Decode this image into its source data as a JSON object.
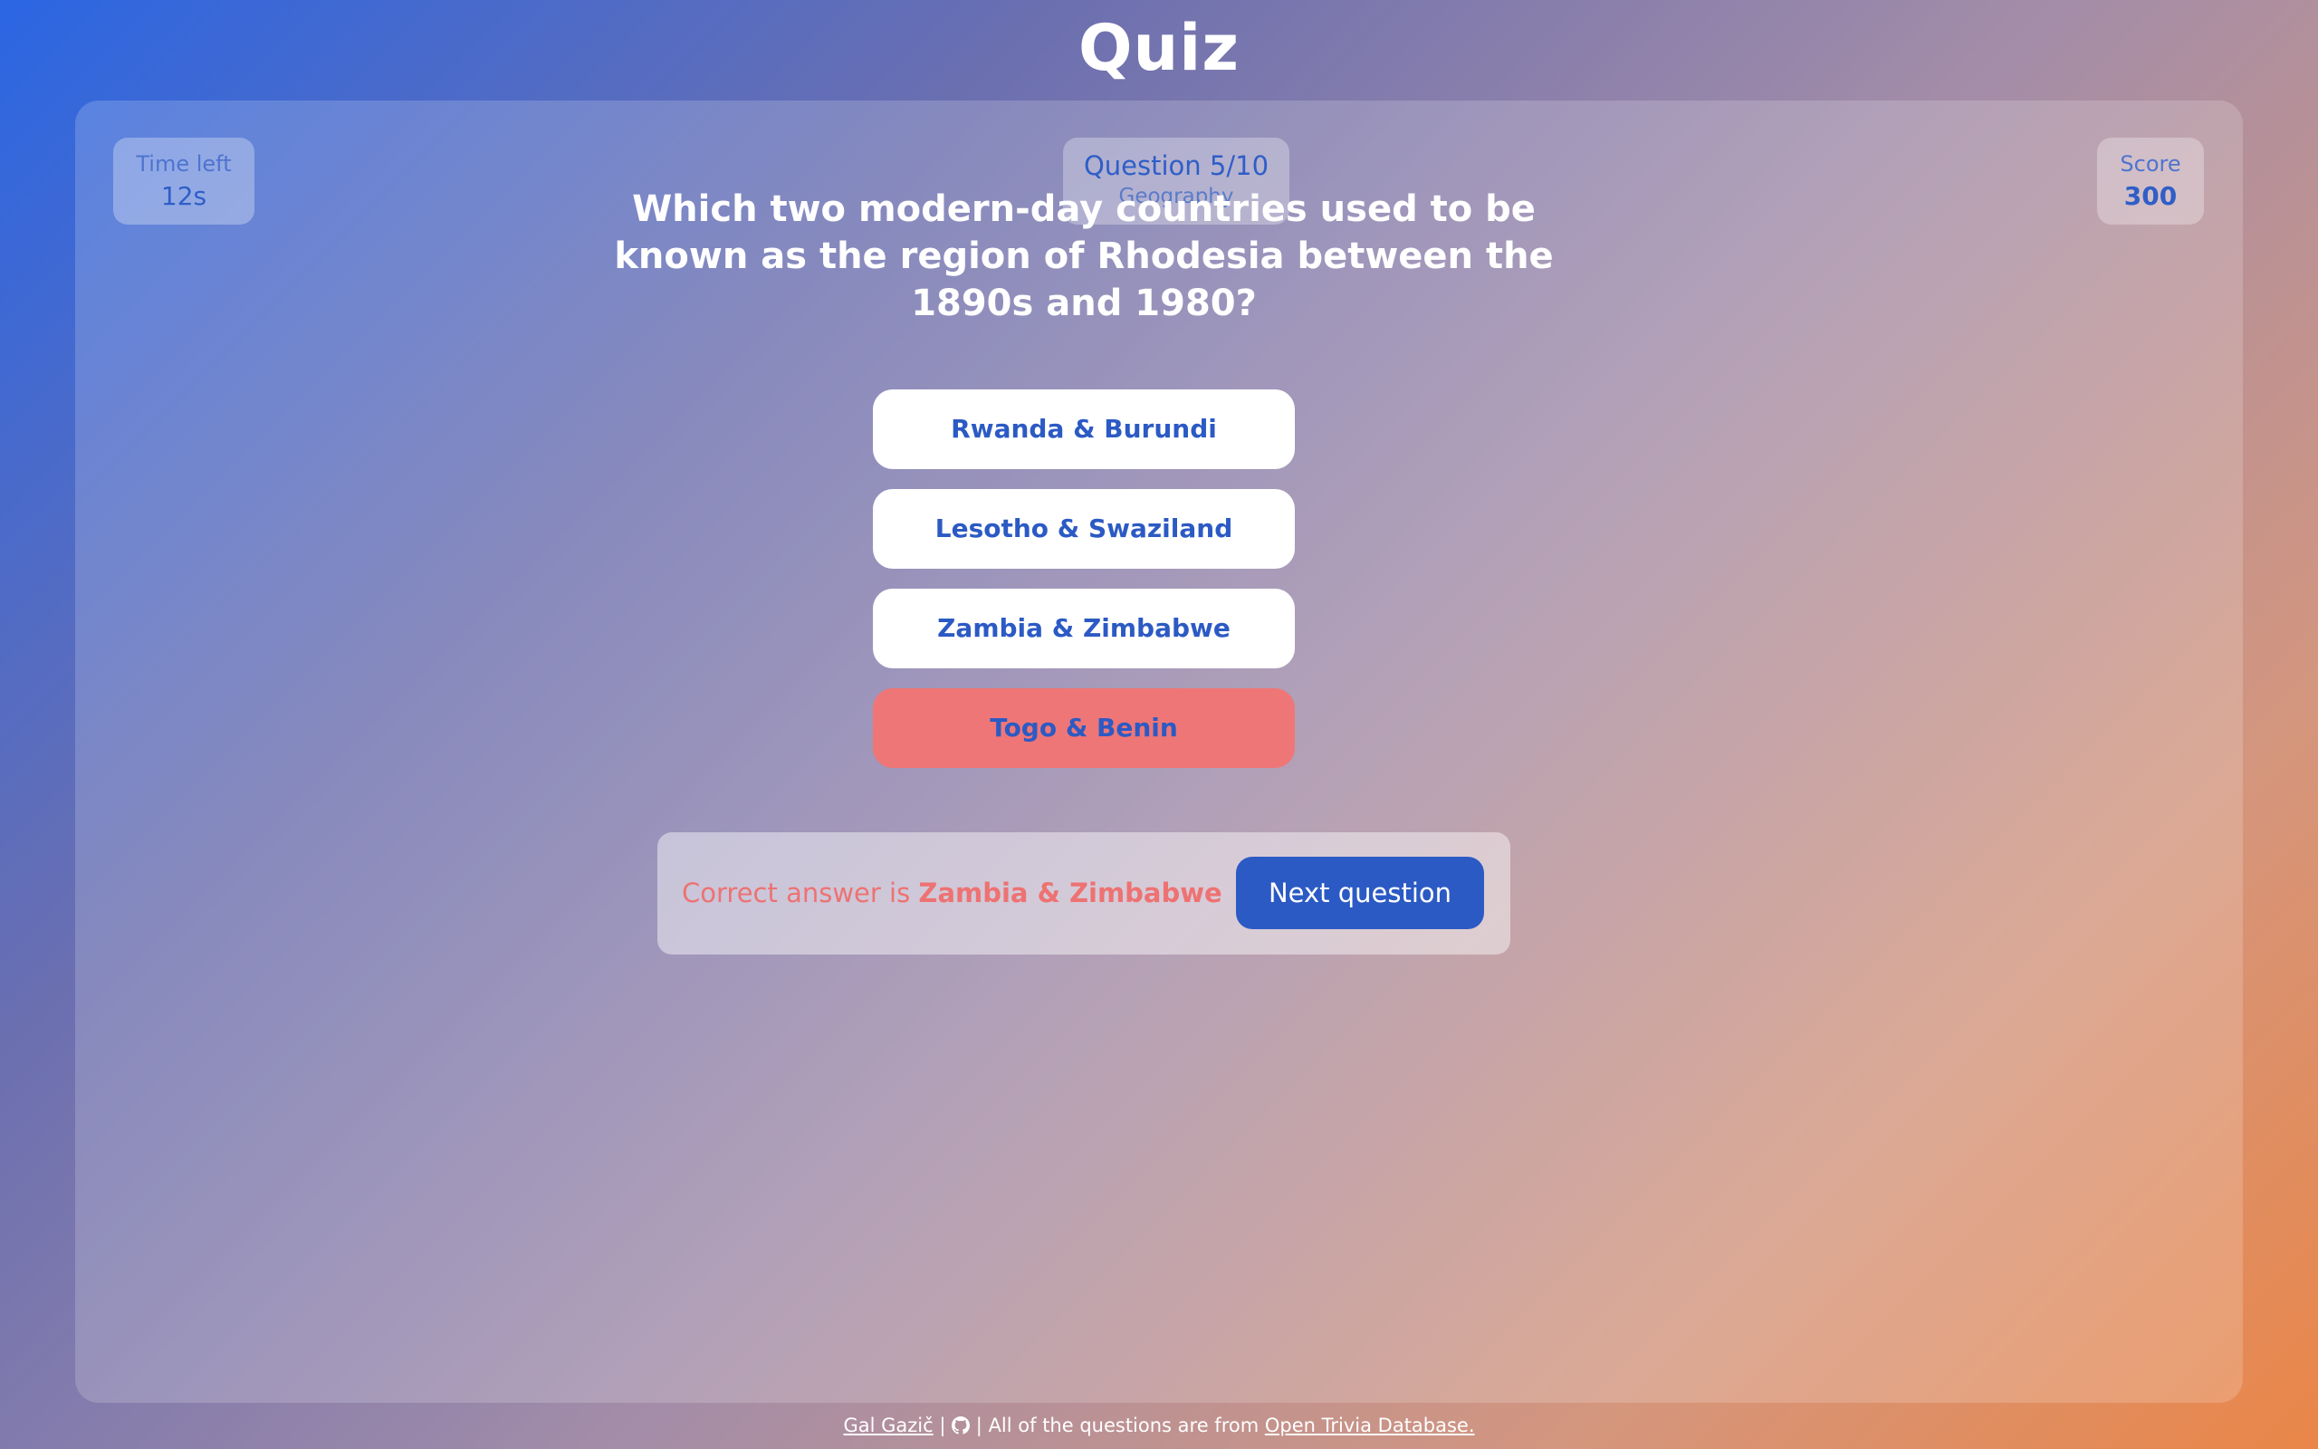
{
  "app": {
    "title": "Quiz"
  },
  "stats": {
    "time_label": "Time left",
    "time_value": "12s",
    "question_label": "Question 5/10",
    "category": "Geography",
    "score_label": "Score",
    "score_value": "300"
  },
  "question": {
    "text": "Which two modern-day countries used to be known as the region of Rhodesia between the 1890s and 1980?"
  },
  "answers": [
    {
      "label": "Rwanda & Burundi",
      "state": "default"
    },
    {
      "label": "Lesotho & Swaziland",
      "state": "default"
    },
    {
      "label": "Zambia & Zimbabwe",
      "state": "default"
    },
    {
      "label": "Togo & Benin",
      "state": "wrong"
    }
  ],
  "feedback": {
    "prefix": "Correct answer is",
    "correct_answer": "Zambia & Zimbabwe",
    "next_label": "Next question"
  },
  "footer": {
    "author": "Gal Gazič",
    "separator": "|",
    "github_icon": "github-icon",
    "source_prefix": "All of the questions are from",
    "source_link": "Open Trivia Database."
  },
  "colors": {
    "accent": "#2c5ac4",
    "wrong": "#ef7676",
    "feedback_text": "#ee7272"
  }
}
